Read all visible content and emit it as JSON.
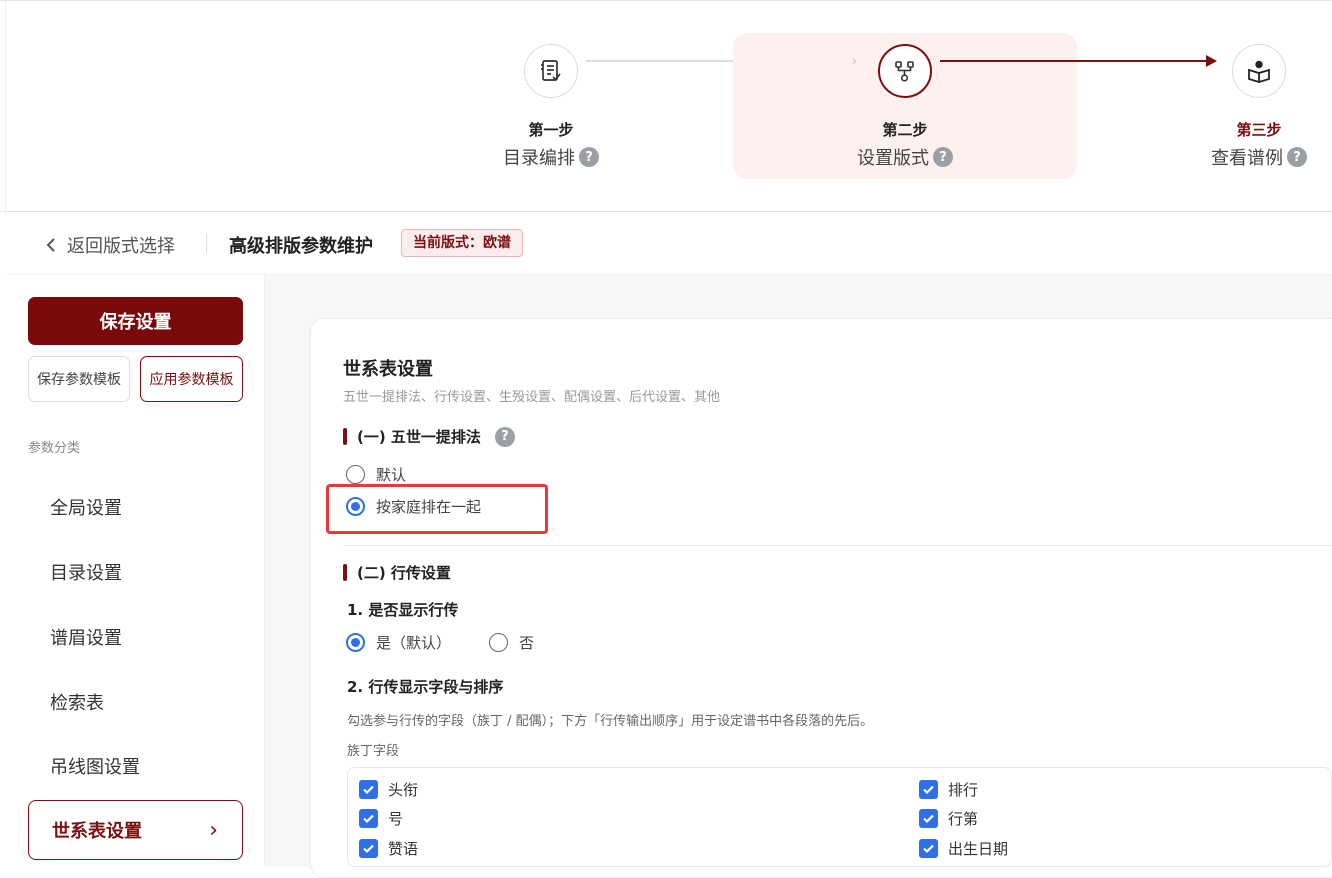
{
  "steps": [
    {
      "num": "第一步",
      "label": "目录编排",
      "help": "?"
    },
    {
      "num": "第二步",
      "label": "设置版式",
      "help": "?"
    },
    {
      "num": "第三步",
      "label": "查看谱例",
      "help": "?"
    }
  ],
  "header": {
    "back_label": "返回版式选择",
    "page_title": "高级排版参数维护",
    "current_badge": "当前版式：欧谱"
  },
  "sidebar": {
    "save_button": "保存设置",
    "save_template": "保存参数模板",
    "apply_template": "应用参数模板",
    "category_title": "参数分类",
    "items": [
      "全局设置",
      "目录设置",
      "谱眉设置",
      "检索表",
      "吊线图设置",
      "世系表设置"
    ],
    "active_arrow": "›"
  },
  "card": {
    "title": "世系表设置",
    "subtitle": "五世一提排法、行传设置、生殁设置、配偶设置、后代设置、其他",
    "section1": {
      "title": "(一) 五世一提排法",
      "help": "?",
      "options": [
        "默认",
        "按家庭排在一起"
      ],
      "selected": 1
    },
    "section2": {
      "title": "(二) 行传设置",
      "q1": "1. 是否显示行传",
      "q1_options": [
        "是（默认）",
        "否"
      ],
      "q1_selected": 0,
      "q2": "2. 行传显示字段与排序",
      "q2_desc": "勾选参与行传的字段（族丁 / 配偶）；下方「行传输出顺序」用于设定谱书中各段落的先后。",
      "group_label": "族丁字段",
      "fields_left": [
        "头衔",
        "号",
        "赞语"
      ],
      "fields_right": [
        "排行",
        "行第",
        "出生日期"
      ]
    }
  },
  "colors": {
    "accent": "#7a1010",
    "primary_blue": "#2f6fe8",
    "highlight": "#e63a3a"
  }
}
